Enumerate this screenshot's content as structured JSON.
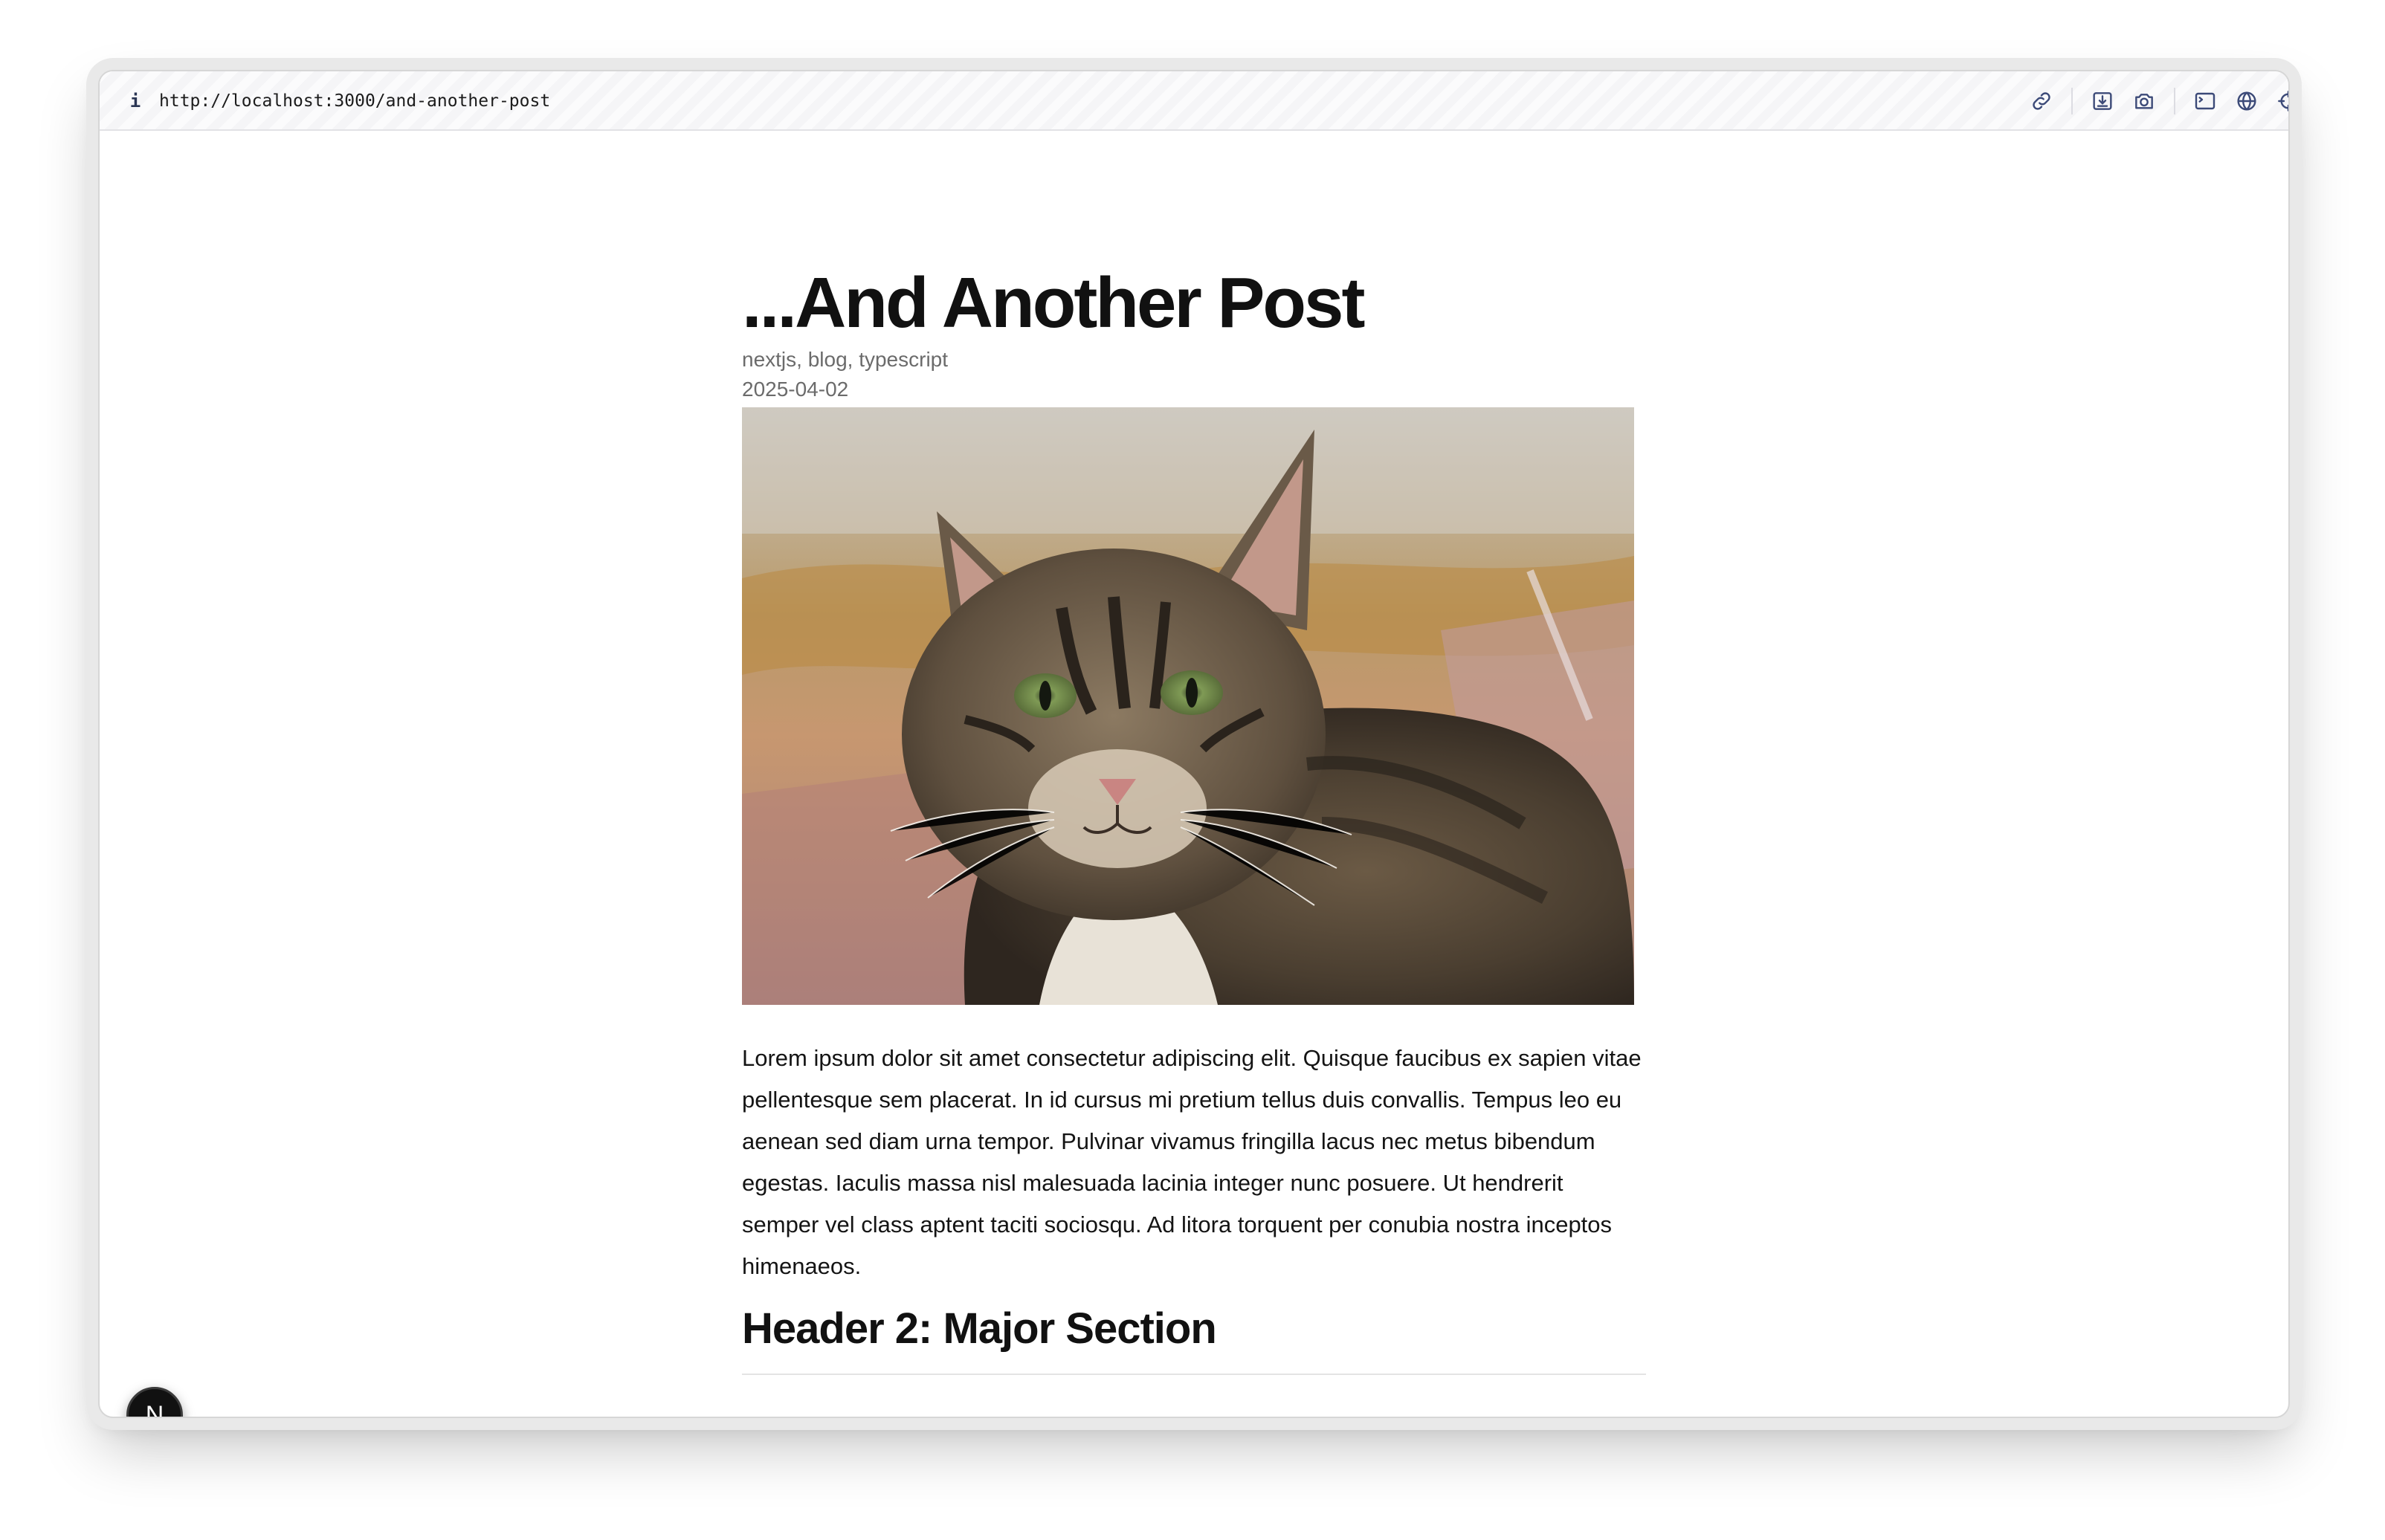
{
  "browser": {
    "info_label": "i",
    "url": "http://localhost:3000/and-another-post",
    "toolbar_icons": [
      "link-icon",
      "download-icon",
      "camera-icon",
      "terminal-icon",
      "globe-icon",
      "crosshair-icon",
      "extensions-icon",
      "split-view-icon"
    ]
  },
  "post": {
    "title": "...And Another Post",
    "tags": "nextjs, blog, typescript",
    "date": "2025-04-02",
    "image": "tabby-cat-photo",
    "paragraph": "Lorem ipsum dolor sit amet consectetur adipiscing elit. Quisque faucibus ex sapien vitae pellentesque sem placerat. In id cursus mi pretium tellus duis convallis. Tempus leo eu aenean sed diam urna tempor. Pulvinar vivamus fringilla lacus nec metus bibendum egestas. Iaculis massa nisl malesuada lacinia integer nunc posuere. Ut hendrerit semper vel class aptent taciti sociosqu. Ad litora torquent per conubia nostra inceptos himenaeos.",
    "section_heading": "Header 2: Major Section"
  },
  "devtools": {
    "badge_label": "N"
  }
}
